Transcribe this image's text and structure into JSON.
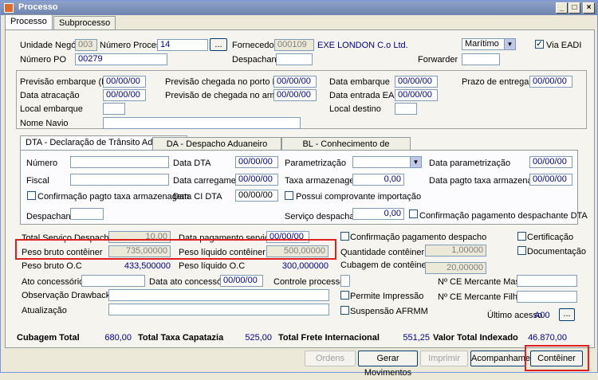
{
  "window": {
    "title": "Processo"
  },
  "tabs": [
    "Processo",
    "Subprocesso"
  ],
  "header": {
    "unidade_label": "Unidade Negócio",
    "unidade_value": "003",
    "numero_processo_label": "Número Processo",
    "numero_processo_value": "14",
    "lookup_label": "...",
    "fornecedor_label": "Fornecedor",
    "fornecedor_code": "000109",
    "fornecedor_name": "EXE LONDON C.o Ltd.",
    "modal_value": "Marítimo",
    "via_eadi_label": "Via EADI",
    "numero_po_label": "Número PO",
    "numero_po_value": "00279",
    "despachante_label": "Despachante",
    "forwarder_label": "Forwarder"
  },
  "datas": {
    "prev_embarque_label": "Previsão embarque (ETD)",
    "prev_embarque_value": "00/00/00",
    "prev_chegada_porto_label": "Previsão chegada no porto ETA",
    "prev_chegada_porto_value": "00/00/00",
    "data_embarque_label": "Data embarque",
    "data_embarque_value": "00/00/00",
    "prazo_entrega_label": "Prazo de entrega",
    "prazo_entrega_value": "00/00/00",
    "data_atracacao_label": "Data atracação",
    "data_atracacao_value": "00/00/00",
    "prev_chegada_armazem_label": "Previsão de chegada no armazém",
    "prev_chegada_armazem_value": "00/00/00",
    "data_entrada_eadi_label": "Data entrada EADI",
    "data_entrada_eadi_value": "00/00/00",
    "local_embarque_label": "Local embarque",
    "local_destino_label": "Local destino",
    "nome_navio_label": "Nome Navio"
  },
  "subtabs": [
    "DTA - Declaração de Trânsito Aduaneiro",
    "DA - Despacho Aduaneiro",
    "BL - Conhecimento de Embarque"
  ],
  "dta": {
    "numero_label": "Número",
    "data_dta_label": "Data DTA",
    "data_dta_value": "00/00/00",
    "parametrizacao_label": "Parametrização",
    "data_parametrizacao_label": "Data parametrização",
    "data_parametrizacao_value": "00/00/00",
    "fiscal_label": "Fiscal",
    "data_carregamento_label": "Data carregamento",
    "data_carregamento_value": "00/00/00",
    "taxa_armazenagem_label": "Taxa armazenagem",
    "taxa_armazenagem_value": "0,00",
    "data_pagto_taxa_label": "Data pagto taxa armazenagem",
    "data_pagto_taxa_value": "00/00/00",
    "confirmacao_pagto_taxa_label": "Confirmação pagto taxa armazenagem",
    "data_ci_dta_label": "Data CI DTA",
    "data_ci_dta_value": "00/00/00",
    "possui_comprovante_label": "Possui comprovante importação",
    "despachante_label": "Despachante",
    "servico_despachante_label": "Serviço despachante",
    "servico_despachante_value": "0,00",
    "confirmacao_pagamento_dta_label": "Confirmação pagamento despachante DTA"
  },
  "lower": {
    "total_servico_label": "Total Serviço Despachante",
    "total_servico_value": "10,00",
    "data_pagamento_servico_label": "Data pagamento serviço",
    "data_pagamento_servico_value": "00/00/00",
    "confirmacao_pagamento_despacho_label": "Confirmação pagamento despacho",
    "certificacao_label": "Certificação",
    "peso_bruto_label": "Peso bruto contêiner",
    "peso_bruto_value": "735,00000",
    "peso_liquido_label": "Peso líquido contêiner",
    "peso_liquido_value": "500,00000",
    "quantidade_conteiner_label": "Quantidade contêiner",
    "quantidade_conteiner_value": "1,00000",
    "documentacao_label": "Documentação",
    "peso_bruto_oc_label": "Peso bruto O.C",
    "peso_bruto_oc_value": "433,500000",
    "peso_liquido_oc_label": "Peso líquido O.C",
    "peso_liquido_oc_value": "300,000000",
    "cubagem_conteineres_label": "Cubagem de contêineres",
    "cubagem_conteineres_value": "20,00000",
    "ato_concessorio_label": "Ato concessório",
    "data_ato_label": "Data ato concessório",
    "data_ato_value": "00/00/00",
    "controle_processo_label": "Controle processo",
    "ce_master_label": "Nº CE Mercante Master",
    "obs_drawback_label": "Observação Drawback",
    "permite_impressao_label": "Permite Impressão",
    "ce_filhote_label": "Nº CE Mercante Filhote",
    "atualizacao_label": "Atualização",
    "suspensao_label": "Suspensão AFRMM",
    "ultimo_acesso_label": "Último acesso",
    "ultimo_acesso_value": "A00",
    "lookup_label": "..."
  },
  "totals": {
    "cubagem_total_label": "Cubagem Total",
    "cubagem_total_value": "680,00",
    "taxa_capatazia_label": "Total Taxa Capatazia",
    "taxa_capatazia_value": "525,00",
    "frete_label": "Total Frete Internacional",
    "frete_value": "551,25",
    "valor_indexado_label": "Valor Total Indexado",
    "valor_indexado_value": "46.870,00"
  },
  "buttons": {
    "ordens": "Ordens",
    "gerar_movimentos": "Gerar Movimentos",
    "imprimir": "Imprimir",
    "acompanhamento": "Acompanhamento",
    "conteiner": "Contêiner"
  },
  "colors": {
    "highlight": "#e02020",
    "value_text": "#00008b"
  }
}
